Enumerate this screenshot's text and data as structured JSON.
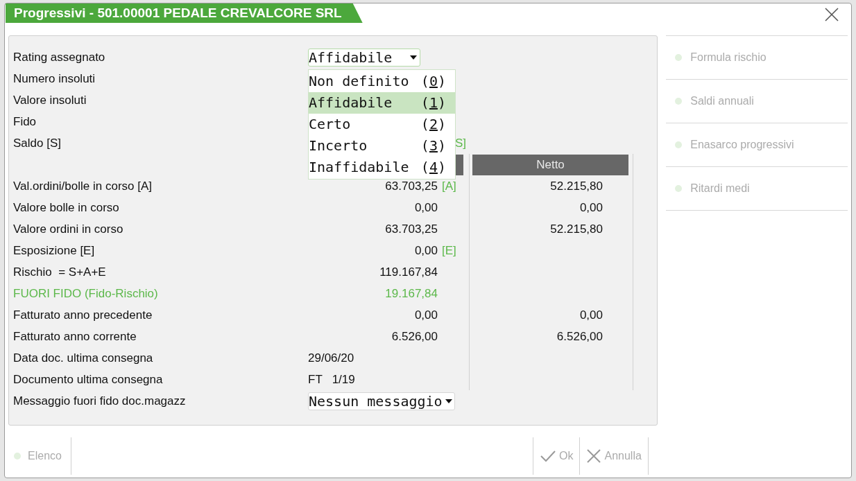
{
  "window": {
    "title": "Progressivi - 501.00001 PEDALE CREVALCORE SRL"
  },
  "top_fields": [
    {
      "label": "Rating assegnato",
      "kind": "select",
      "value": "Affidabile",
      "expanded": true
    },
    {
      "label": "Numero insoluti",
      "kind": "plain"
    },
    {
      "label": "Valore insoluti",
      "kind": "plain"
    },
    {
      "label": "Fido",
      "kind": "plain"
    },
    {
      "label": "Saldo [S]",
      "kind": "plain",
      "tag": "S]"
    }
  ],
  "rating_options": [
    {
      "label": "Non definito",
      "shortcut": "(0)",
      "selected": false
    },
    {
      "label": "Affidabile",
      "shortcut": "(1)",
      "selected": true
    },
    {
      "label": "Certo",
      "shortcut": "(2)",
      "selected": false
    },
    {
      "label": "Incerto",
      "shortcut": "(3)",
      "selected": false
    },
    {
      "label": "Inaffidabile",
      "shortcut": "(4)",
      "selected": false
    }
  ],
  "table": {
    "column_2_header": "Netto",
    "rows": [
      {
        "label": "Val.ordini/bolle in corso [A]",
        "kind": "amount",
        "value": "63.703,25",
        "tag": "[A]",
        "netto": "52.215,80",
        "highlight": false
      },
      {
        "label": "Valore bolle in corso",
        "kind": "amount",
        "value": "0,00",
        "netto": "0,00",
        "highlight": false
      },
      {
        "label": "Valore ordini in corso",
        "kind": "amount",
        "value": "63.703,25",
        "netto": "52.215,80",
        "highlight": false
      },
      {
        "label": "Esposizione [E]",
        "kind": "amount",
        "value": "0,00",
        "tag": "[E]",
        "highlight": false
      },
      {
        "label": "Rischio  = S+A+E",
        "kind": "amount",
        "value": "119.167,84",
        "highlight": false
      },
      {
        "label": "FUORI FIDO (Fido-Rischio)",
        "kind": "amount",
        "value": "19.167,84",
        "highlight": true
      },
      {
        "label": "Fatturato anno precedente",
        "kind": "amount",
        "value": "0,00",
        "netto": "0,00",
        "highlight": false
      },
      {
        "label": "Fatturato anno corrente",
        "kind": "amount",
        "value": "6.526,00",
        "netto": "6.526,00",
        "highlight": false
      },
      {
        "label": "Data doc. ultima consegna",
        "kind": "text",
        "value": "29/06/20",
        "highlight": false
      },
      {
        "label": "Documento ultima consegna",
        "kind": "text",
        "value": "FT   1/19",
        "highlight": false
      }
    ]
  },
  "message_field": {
    "label": "Messaggio fuori fido doc.magazz",
    "value": "Nessun messaggio"
  },
  "side_menu": [
    {
      "label": "Formula rischio",
      "disabled": true
    },
    {
      "label": "Saldi annuali",
      "disabled": true
    },
    {
      "label": "Enasarco progressivi",
      "disabled": true
    },
    {
      "label": "Ritardi medi",
      "disabled": true
    }
  ],
  "footer": {
    "left": [
      {
        "kind": "dot",
        "label": "Elenco",
        "disabled": true
      }
    ],
    "right": [
      {
        "kind": "check",
        "label": "Ok",
        "disabled": true
      },
      {
        "kind": "cross",
        "label": "Annulla",
        "disabled": true
      }
    ]
  }
}
